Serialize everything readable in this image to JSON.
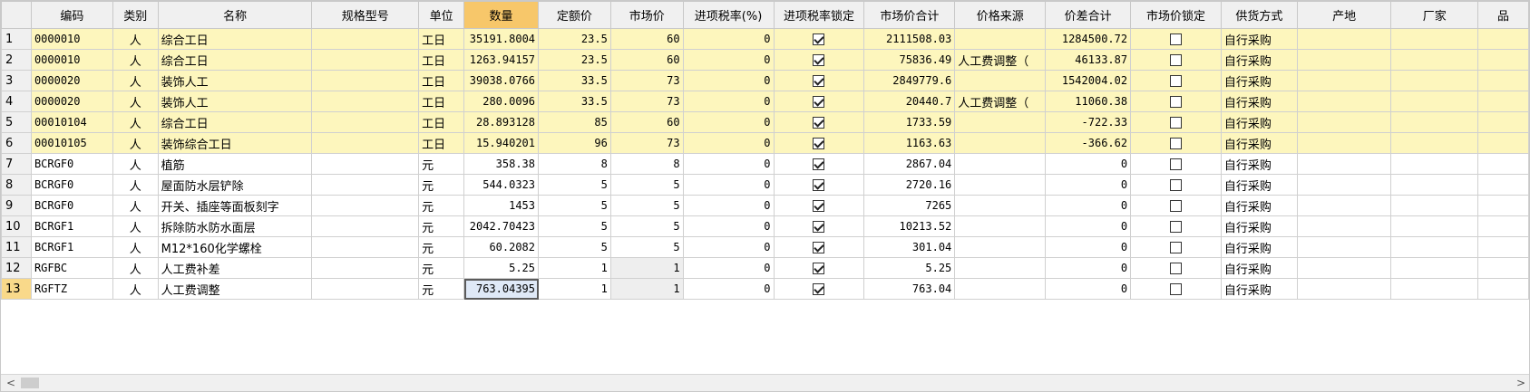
{
  "columns": [
    "",
    "编码",
    "类别",
    "名称",
    "规格型号",
    "单位",
    "数量",
    "定额价",
    "市场价",
    "进项税率(%)",
    "进项税率锁定",
    "市场价合计",
    "价格来源",
    "价差合计",
    "市场价锁定",
    "供货方式",
    "产地",
    "厂家",
    "品"
  ],
  "sorted_column": "数量",
  "rows": [
    {
      "n": "1",
      "code": "0000010",
      "cat": "人",
      "name": "综合工日",
      "spec": "",
      "unit": "工日",
      "qty": "35191.8004",
      "quota": "23.5",
      "market": "60",
      "tax": "0",
      "taxlock": true,
      "mtotal": "2111508.03",
      "source": "",
      "diff": "1284500.72",
      "mlock": false,
      "supply": "自行采购",
      "hl": true
    },
    {
      "n": "2",
      "code": "0000010",
      "cat": "人",
      "name": "综合工日",
      "spec": "",
      "unit": "工日",
      "qty": "1263.94157",
      "quota": "23.5",
      "market": "60",
      "tax": "0",
      "taxlock": true,
      "mtotal": "75836.49",
      "source": "人工费调整（",
      "diff": "46133.87",
      "mlock": false,
      "supply": "自行采购",
      "hl": true
    },
    {
      "n": "3",
      "code": "0000020",
      "cat": "人",
      "name": "装饰人工",
      "spec": "",
      "unit": "工日",
      "qty": "39038.0766",
      "quota": "33.5",
      "market": "73",
      "tax": "0",
      "taxlock": true,
      "mtotal": "2849779.6",
      "source": "",
      "diff": "1542004.02",
      "mlock": false,
      "supply": "自行采购",
      "hl": true
    },
    {
      "n": "4",
      "code": "0000020",
      "cat": "人",
      "name": "装饰人工",
      "spec": "",
      "unit": "工日",
      "qty": "280.0096",
      "quota": "33.5",
      "market": "73",
      "tax": "0",
      "taxlock": true,
      "mtotal": "20440.7",
      "source": "人工费调整（",
      "diff": "11060.38",
      "mlock": false,
      "supply": "自行采购",
      "hl": true
    },
    {
      "n": "5",
      "code": "00010104",
      "cat": "人",
      "name": "综合工日",
      "spec": "",
      "unit": "工日",
      "qty": "28.893128",
      "quota": "85",
      "market": "60",
      "tax": "0",
      "taxlock": true,
      "mtotal": "1733.59",
      "source": "",
      "diff": "-722.33",
      "mlock": false,
      "supply": "自行采购",
      "hl": true
    },
    {
      "n": "6",
      "code": "00010105",
      "cat": "人",
      "name": "装饰综合工日",
      "spec": "",
      "unit": "工日",
      "qty": "15.940201",
      "quota": "96",
      "market": "73",
      "tax": "0",
      "taxlock": true,
      "mtotal": "1163.63",
      "source": "",
      "diff": "-366.62",
      "mlock": false,
      "supply": "自行采购",
      "hl": true
    },
    {
      "n": "7",
      "code": "BCRGF0",
      "cat": "人",
      "name": "植筋",
      "spec": "",
      "unit": "元",
      "qty": "358.38",
      "quota": "8",
      "market": "8",
      "tax": "0",
      "taxlock": true,
      "mtotal": "2867.04",
      "source": "",
      "diff": "0",
      "mlock": false,
      "supply": "自行采购",
      "hl": false
    },
    {
      "n": "8",
      "code": "BCRGF0",
      "cat": "人",
      "name": "屋面防水层铲除",
      "spec": "",
      "unit": "元",
      "qty": "544.0323",
      "quota": "5",
      "market": "5",
      "tax": "0",
      "taxlock": true,
      "mtotal": "2720.16",
      "source": "",
      "diff": "0",
      "mlock": false,
      "supply": "自行采购",
      "hl": false
    },
    {
      "n": "9",
      "code": "BCRGF0",
      "cat": "人",
      "name": "开关、插座等面板刻字",
      "spec": "",
      "unit": "元",
      "qty": "1453",
      "quota": "5",
      "market": "5",
      "tax": "0",
      "taxlock": true,
      "mtotal": "7265",
      "source": "",
      "diff": "0",
      "mlock": false,
      "supply": "自行采购",
      "hl": false
    },
    {
      "n": "10",
      "code": "BCRGF1",
      "cat": "人",
      "name": "拆除防水防水面层",
      "spec": "",
      "unit": "元",
      "qty": "2042.70423",
      "quota": "5",
      "market": "5",
      "tax": "0",
      "taxlock": true,
      "mtotal": "10213.52",
      "source": "",
      "diff": "0",
      "mlock": false,
      "supply": "自行采购",
      "hl": false
    },
    {
      "n": "11",
      "code": "BCRGF1",
      "cat": "人",
      "name": "M12*160化学螺栓",
      "spec": "",
      "unit": "元",
      "qty": "60.2082",
      "quota": "5",
      "market": "5",
      "tax": "0",
      "taxlock": true,
      "mtotal": "301.04",
      "source": "",
      "diff": "0",
      "mlock": false,
      "supply": "自行采购",
      "hl": false
    },
    {
      "n": "12",
      "code": "RGFBC",
      "cat": "人",
      "name": "人工费补差",
      "spec": "",
      "unit": "元",
      "qty": "5.25",
      "quota": "1",
      "market": "1",
      "tax": "0",
      "taxlock": true,
      "mtotal": "5.25",
      "source": "",
      "diff": "0",
      "mlock": false,
      "supply": "自行采购",
      "hl": false,
      "gray_market": true
    },
    {
      "n": "13",
      "code": "RGFTZ",
      "cat": "人",
      "name": "人工费调整",
      "spec": "",
      "unit": "元",
      "qty": "763.04395",
      "quota": "1",
      "market": "1",
      "tax": "0",
      "taxlock": true,
      "mtotal": "763.04",
      "source": "",
      "diff": "0",
      "mlock": false,
      "supply": "自行采购",
      "hl": false,
      "gray_market": true,
      "current": true
    }
  ],
  "scrollbar": {
    "left_arrow": "<",
    "right_arrow": ">"
  }
}
